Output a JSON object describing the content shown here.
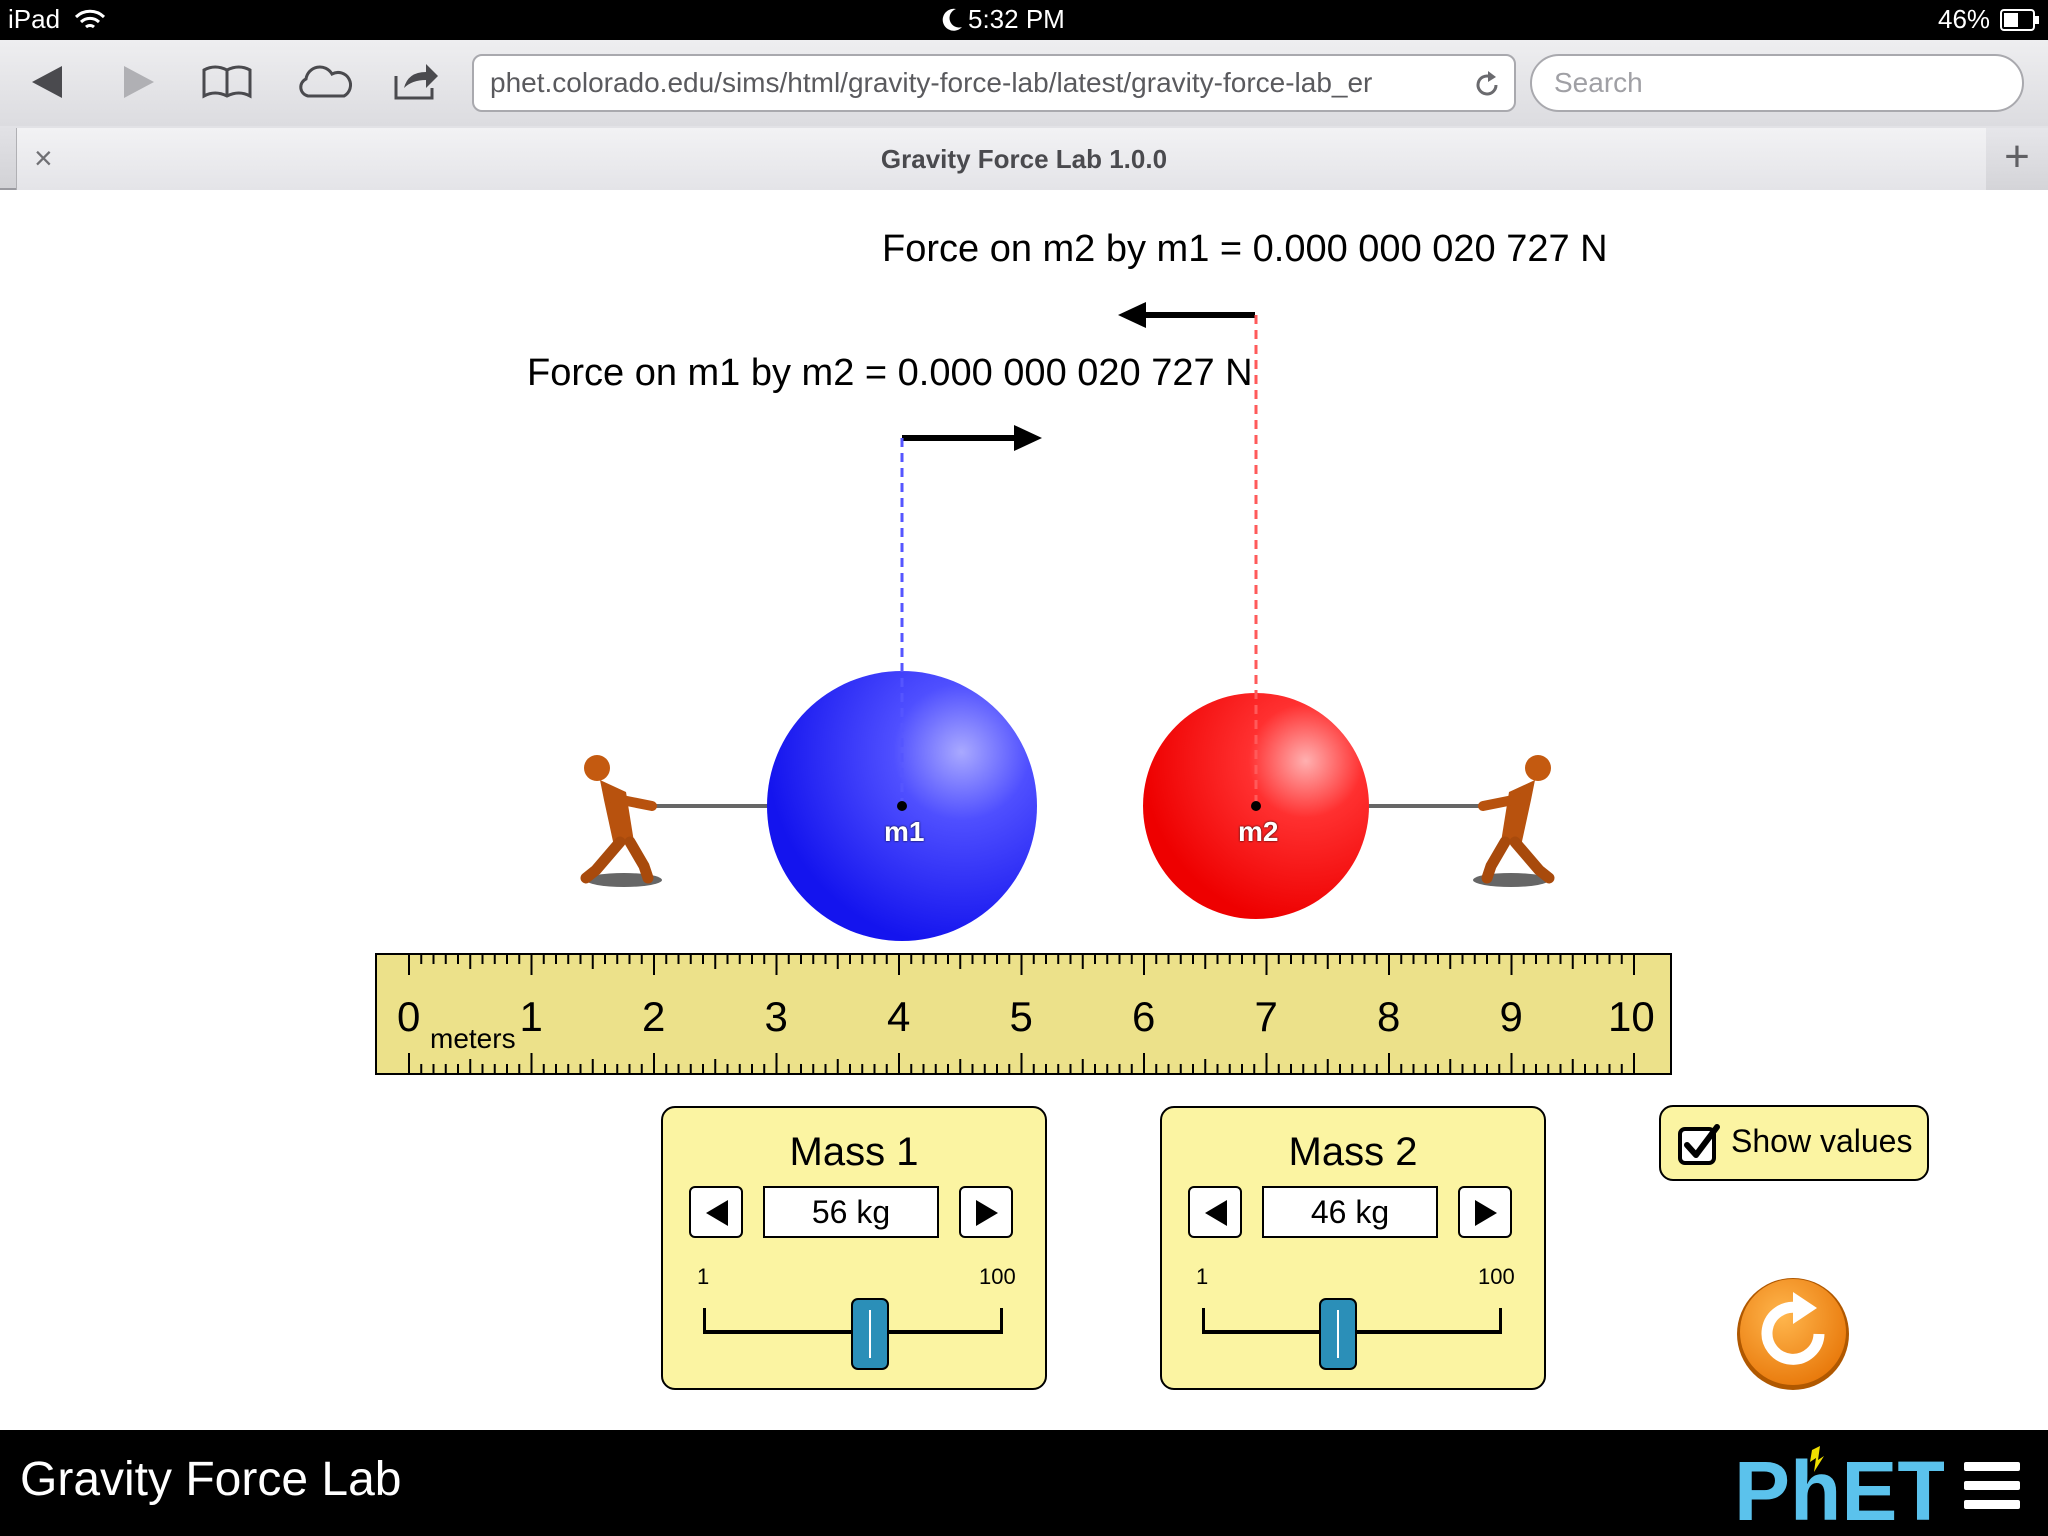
{
  "status_bar": {
    "device": "iPad",
    "time": "5:32 PM",
    "battery": "46%"
  },
  "browser": {
    "url": "phet.colorado.edu/sims/html/gravity-force-lab/latest/gravity-force-lab_er",
    "search_placeholder": "Search",
    "tab_title": "Gravity Force Lab 1.0.0",
    "tab_close": "×",
    "tab_add": "+",
    "toolbar_icons": [
      "back-icon",
      "forward-icon",
      "bookmarks-icon",
      "icloud-tabs-icon",
      "share-icon",
      "reload-icon"
    ]
  },
  "sim": {
    "force_m2_label": "Force on m2 by m1 = 0.000 000 020 727 N",
    "force_m1_label": "Force on m1 by m2 = 0.000 000 020 727 N",
    "mass1_label": "m1",
    "mass2_label": "m2",
    "mass1_color": "#1a1aff",
    "mass2_color": "#ff0000",
    "ruler": {
      "numbers": [
        "0",
        "1",
        "2",
        "3",
        "4",
        "5",
        "6",
        "7",
        "8",
        "9",
        "10"
      ],
      "unit": "meters",
      "color": "#ece18a"
    },
    "mass1_panel": {
      "title": "Mass 1",
      "value": "56 kg",
      "min_label": "1",
      "max_label": "100",
      "level": 56
    },
    "mass2_panel": {
      "title": "Mass 2",
      "value": "46 kg",
      "min_label": "1",
      "max_label": "100",
      "level": 46
    },
    "show_values": {
      "label": "Show values",
      "checked": true
    },
    "reset_icon": "reset-all-icon"
  },
  "nav_bar": {
    "title": "Gravity Force Lab",
    "logo": "PhET",
    "menu_icon": "hamburger-menu-icon"
  }
}
